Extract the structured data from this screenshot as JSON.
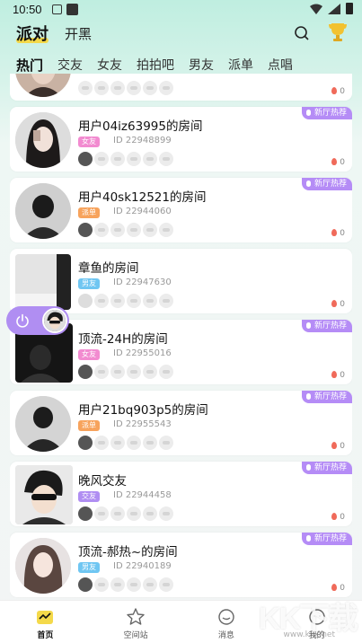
{
  "status": {
    "time": "10:50"
  },
  "top_tabs": {
    "active": "派对",
    "other": "开黑"
  },
  "categories": [
    "热门",
    "交友",
    "女友",
    "拍拍吧",
    "男友",
    "派单",
    "点唱"
  ],
  "hot_tag": "新厅热荐",
  "rooms": [
    {
      "title": "",
      "badge": "",
      "badge_color": "",
      "id": "",
      "heat": "0",
      "hot": false
    },
    {
      "title": "用户04iz63995的房间",
      "badge": "女友",
      "badge_color": "#f28bd0",
      "id": "ID 22948899",
      "heat": "0",
      "hot": true
    },
    {
      "title": "用户40sk12521的房间",
      "badge": "派单",
      "badge_color": "#f7a35c",
      "id": "ID 22944060",
      "heat": "0",
      "hot": true
    },
    {
      "title": "章鱼的房间",
      "badge": "男友",
      "badge_color": "#6fc6f2",
      "id": "ID 22947630",
      "heat": "0",
      "hot": false
    },
    {
      "title": "顶流-24H的房间",
      "badge": "女友",
      "badge_color": "#f28bd0",
      "id": "ID 22955016",
      "heat": "0",
      "hot": true
    },
    {
      "title": "用户21bq903p5的房间",
      "badge": "派单",
      "badge_color": "#f7a35c",
      "id": "ID 22955543",
      "heat": "0",
      "hot": true
    },
    {
      "title": "晚风交友",
      "badge": "交友",
      "badge_color": "#b08ef2",
      "id": "ID 22944458",
      "heat": "0",
      "hot": true
    },
    {
      "title": "顶流-郝热~的房间",
      "badge": "男友",
      "badge_color": "#6fc6f2",
      "id": "ID 22940189",
      "heat": "0",
      "hot": true
    }
  ],
  "bottom_nav": [
    {
      "label": "首页",
      "icon": "home-icon"
    },
    {
      "label": "空间站",
      "icon": "star-icon"
    },
    {
      "label": "消息",
      "icon": "message-icon"
    },
    {
      "label": "我的",
      "icon": "profile-icon"
    }
  ],
  "watermark": {
    "text": "KK下载",
    "url": "www.kkx.net"
  },
  "colors": {
    "accent": "#b08ef2",
    "tab_highlight": "#f4d94a",
    "heat": "#f06a5a"
  }
}
